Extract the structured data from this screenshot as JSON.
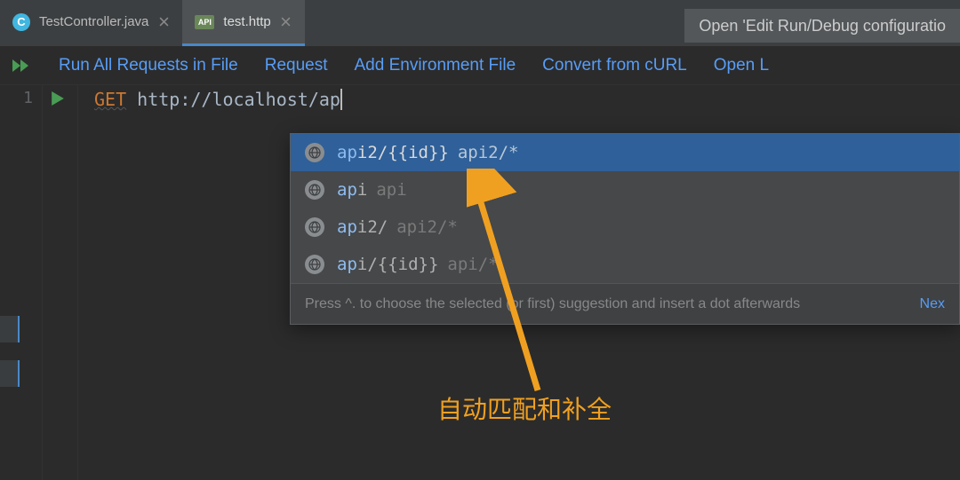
{
  "tabs": [
    {
      "label": "TestController.java",
      "icon": "C"
    },
    {
      "label": "test.http",
      "icon": "API"
    }
  ],
  "banner": "Open 'Edit Run/Debug configuratio",
  "toolbar": {
    "run_all": "Run All Requests in File",
    "request": "Request",
    "add_env": "Add Environment File",
    "convert": "Convert from cURL",
    "open": "Open L"
  },
  "editor": {
    "line_no": "1",
    "method": "GET",
    "url": "http://localhost/ap"
  },
  "completion": {
    "items": [
      {
        "prefix": "ap",
        "rest": "i2/{{id}}",
        "hint": "api2/*"
      },
      {
        "prefix": "ap",
        "rest": "i",
        "hint": "api"
      },
      {
        "prefix": "ap",
        "rest": "i2/",
        "hint": "api2/*"
      },
      {
        "prefix": "ap",
        "rest": "i/{{id}}",
        "hint": "api/*"
      }
    ],
    "footer": "Press ^. to choose the selected (or first) suggestion and insert a dot afterwards",
    "footer_next": "Nex"
  },
  "annotation": "自动匹配和补全"
}
